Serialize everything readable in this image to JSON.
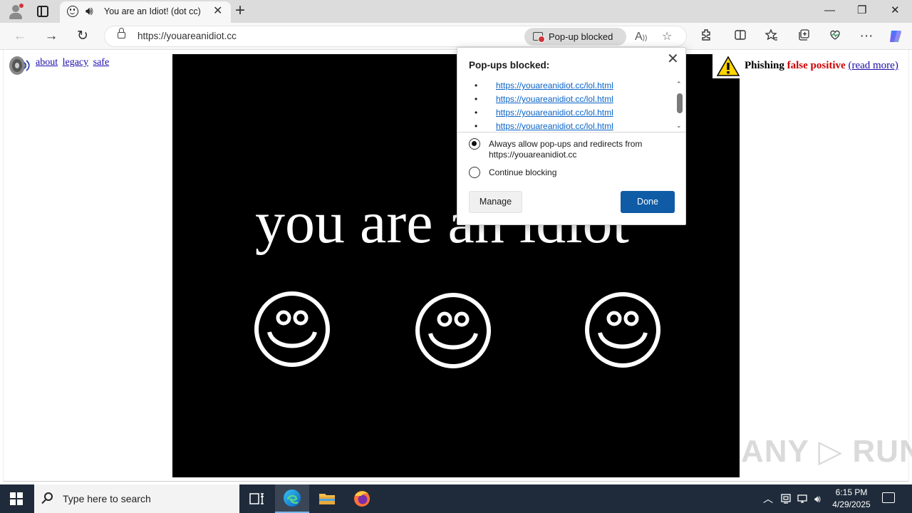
{
  "browser": {
    "tab": {
      "title": "You are an Idiot! (dot cc)",
      "close_glyph": "✕"
    },
    "new_tab_glyph": "+",
    "window_controls": {
      "minimize": "—",
      "restore": "❐",
      "close": "✕"
    },
    "nav": {
      "back": "←",
      "forward": "→",
      "refresh": "↻"
    },
    "address": {
      "url": "https://youareanidiot.cc"
    },
    "popup_indicator": {
      "label": "Pop-up blocked"
    },
    "toolbar_icons": [
      "read-aloud-icon",
      "favorite-star-icon",
      "extensions-icon",
      "split-screen-icon",
      "favorites-icon",
      "collections-icon",
      "browser-essentials-icon",
      "more-icon",
      "copilot-icon"
    ]
  },
  "page": {
    "links": [
      "about",
      "legacy",
      "safe"
    ],
    "headline": "you are an idiot",
    "phishing_banner": {
      "word1": "Phishing",
      "word2": "false positive",
      "link": "(read more)"
    },
    "watermark": "ANY ▷ RUN"
  },
  "popup_dialog": {
    "title": "Pop-ups blocked:",
    "blocked_urls": [
      "https://youareanidiot.cc/lol.html",
      "https://youareanidiot.cc/lol.html",
      "https://youareanidiot.cc/lol.html",
      "https://youareanidiot.cc/lol.html"
    ],
    "option_allow": "Always allow pop-ups and redirects from https://youareanidiot.cc",
    "option_allow_selected": true,
    "option_block": "Continue blocking",
    "manage_label": "Manage",
    "done_label": "Done",
    "accent_color": "#0f5ba6"
  },
  "taskbar": {
    "search_placeholder": "Type here to search",
    "time": "6:15 PM",
    "date": "4/29/2025"
  }
}
